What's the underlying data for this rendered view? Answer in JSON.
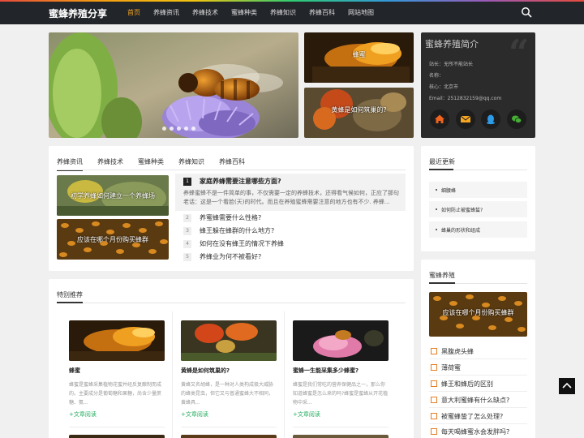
{
  "header": {
    "logo": "蜜蜂养殖分享",
    "nav": [
      "首页",
      "养蜂资讯",
      "养蜂技术",
      "蜜蜂种类",
      "养蜂知识",
      "养蜂百科",
      "网站地图"
    ],
    "active_index": 0,
    "search_icon": "search-icon"
  },
  "banner": {
    "thumbs": [
      "蜂蜜",
      "黄蜂是如何筑巢的?"
    ]
  },
  "profile": {
    "title": "蜜蜂养殖简介",
    "lines": [
      "站长：无所不能站长",
      "名称：",
      "核心：北京市",
      "Email：2512832159@qq.com"
    ],
    "social": [
      {
        "icon": "home-icon",
        "color": "#f0641e"
      },
      {
        "icon": "mail-icon",
        "color": "#f5a623"
      },
      {
        "icon": "qq-icon",
        "color": "#2d9be8"
      },
      {
        "icon": "wechat-icon",
        "color": "#45b035"
      }
    ]
  },
  "news": {
    "tabs": [
      "养蜂资讯",
      "养蜂技术",
      "蜜蜂种类",
      "养蜂知识",
      "养蜂百科"
    ],
    "active_tab": 0,
    "images": [
      "初学养蜂如何建立一个养蜂场",
      "应该在哪个月份购买蜂群"
    ],
    "featured": {
      "num": "1",
      "title": "家庭养蜂需要注意哪些方面?",
      "excerpt": "养蜂蜜蜂不是一件简单的事，不仅需要一定的养蜂技术，还得看气候如何，正应了那句老话：这是一个看脸(天)的时代。而且在养殖蜜蜂需要注意的地方也有不少. 养蜂..."
    },
    "items": [
      {
        "num": "2",
        "title": "养蜜蜂需要什么性格?"
      },
      {
        "num": "3",
        "title": "蜂王躲在蜂群的什么地方?"
      },
      {
        "num": "4",
        "title": "如何在没有蜂王的情况下养蜂"
      },
      {
        "num": "5",
        "title": "养蜂业为何不被看好?"
      }
    ]
  },
  "recent": {
    "title": "最近更新",
    "items": [
      "细腰蜂",
      "如何防止被蜜蜂蜇?",
      "蜂巢的形状和组成"
    ]
  },
  "farming": {
    "title": "蜜蜂养殖",
    "image_caption": "应该在哪个月份购买蜂群",
    "items": [
      "黑腹虎头蜂",
      "薄荷蜜",
      "蜂王和蜂后的区别",
      "意大利蜜蜂有什么缺点?",
      "被蜜蜂蛰了怎么处理?",
      "每天喝蜂蜜水会发胖吗?"
    ]
  },
  "special": {
    "title": "特别推荐",
    "more_label": "+文章阅读",
    "posts": [
      {
        "title": "蜂蜜",
        "excerpt": "蜂蜜是蜜蜂采集植物花蜜并经反复酿制而成的。主要成分是葡萄糖和果糖，尚含少量蔗糖、氨..."
      },
      {
        "title": "黄蜂是如何筑巢的?",
        "excerpt": "黄蜂又名胡蜂，是一种对人类构成极大威胁的蜂类昆虫，但它又与普通蜜蜂大不相同，黄蜂具..."
      },
      {
        "title": "蜜蜂一生能采集多少蜂蜜?",
        "excerpt": "蜂蜜是我们常吃的营养保健品之一，那么你知道蜂蜜是怎么来的吗?蜂蜜是蜜蜂从开花植物中采..."
      }
    ]
  },
  "backtop_icon": "arrow-up-icon"
}
